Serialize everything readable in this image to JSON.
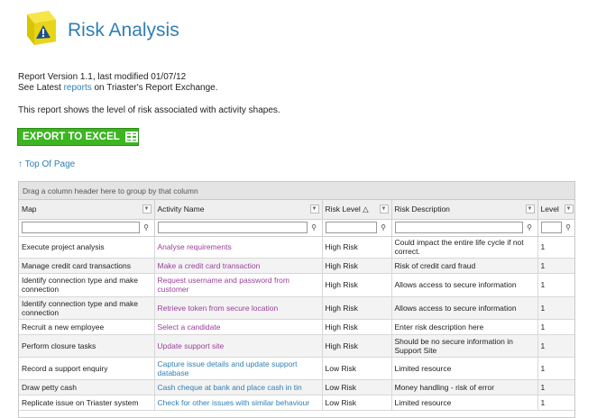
{
  "header": {
    "title": "Risk Analysis"
  },
  "meta": {
    "line1": "Report Version 1.1, last modified 01/07/12",
    "line2_prefix": "See Latest ",
    "line2_link": "reports",
    "line2_suffix": " on Triaster's Report Exchange."
  },
  "description": "This report shows the level of risk associated with activity shapes.",
  "export_label": "EXPORT TO EXCEL",
  "top_link": "↑ Top Of Page",
  "grid": {
    "group_hint": "Drag a column header here to group by that column",
    "columns": [
      "Map",
      "Activity Name",
      "Risk Level",
      "Risk Description",
      "Level"
    ],
    "sort_indicator": "△",
    "rows": [
      {
        "map": "Execute project analysis",
        "activity": "Analyse requirements",
        "risk": "High Risk",
        "desc": "Could impact the entire life cycle if not correct.",
        "level": "1",
        "h": 24,
        "color": "purple"
      },
      {
        "map": "Manage credit card transactions",
        "activity": "Make a credit card transaction",
        "risk": "High Risk",
        "desc": "Risk of credit card fraud",
        "level": "1",
        "h": 17,
        "color": "purple"
      },
      {
        "map": "Identify connection type and make connection",
        "activity": "Request username and password from customer",
        "risk": "High Risk",
        "desc": "Allows access to secure information",
        "level": "1",
        "h": 26,
        "color": "purple"
      },
      {
        "map": "Identify connection type and make connection",
        "activity": "Retrieve token from secure location",
        "risk": "High Risk",
        "desc": "Allows access to secure information",
        "level": "1",
        "h": 25,
        "color": "purple"
      },
      {
        "map": "Recruit a new employee",
        "activity": "Select a candidate",
        "risk": "High Risk",
        "desc": "Enter risk description here",
        "level": "1",
        "h": 17,
        "color": "purple"
      },
      {
        "map": "Perform closure tasks",
        "activity": "Update support site",
        "risk": "High Risk",
        "desc": "Should be no secure information in Support Site",
        "level": "1",
        "h": 25,
        "color": "purple"
      },
      {
        "map": "Record a support enquiry",
        "activity": "Capture issue details and update support database",
        "risk": "Low Risk",
        "desc": "Limited resource",
        "level": "1",
        "h": 25,
        "color": "blue"
      },
      {
        "map": "Draw petty cash",
        "activity": "Cash cheque at bank and place cash in tin",
        "risk": "Low Risk",
        "desc": "Money handling - risk of error",
        "level": "1",
        "h": 17,
        "color": "blue"
      },
      {
        "map": "Replicate issue on Triaster system",
        "activity": "Check for other issues with similar behaviour",
        "risk": "Low Risk",
        "desc": "Limited resource",
        "level": "1",
        "h": 17,
        "color": "blue"
      }
    ]
  },
  "colors": {
    "accent": "#2f7fb5",
    "export_green": "#3cb521",
    "activity_purple": "#9b3f9b"
  },
  "icons": {
    "logo": "warning-cube-icon",
    "dropdown": "chevron-down-icon",
    "filter": "filter-funnel-icon"
  }
}
